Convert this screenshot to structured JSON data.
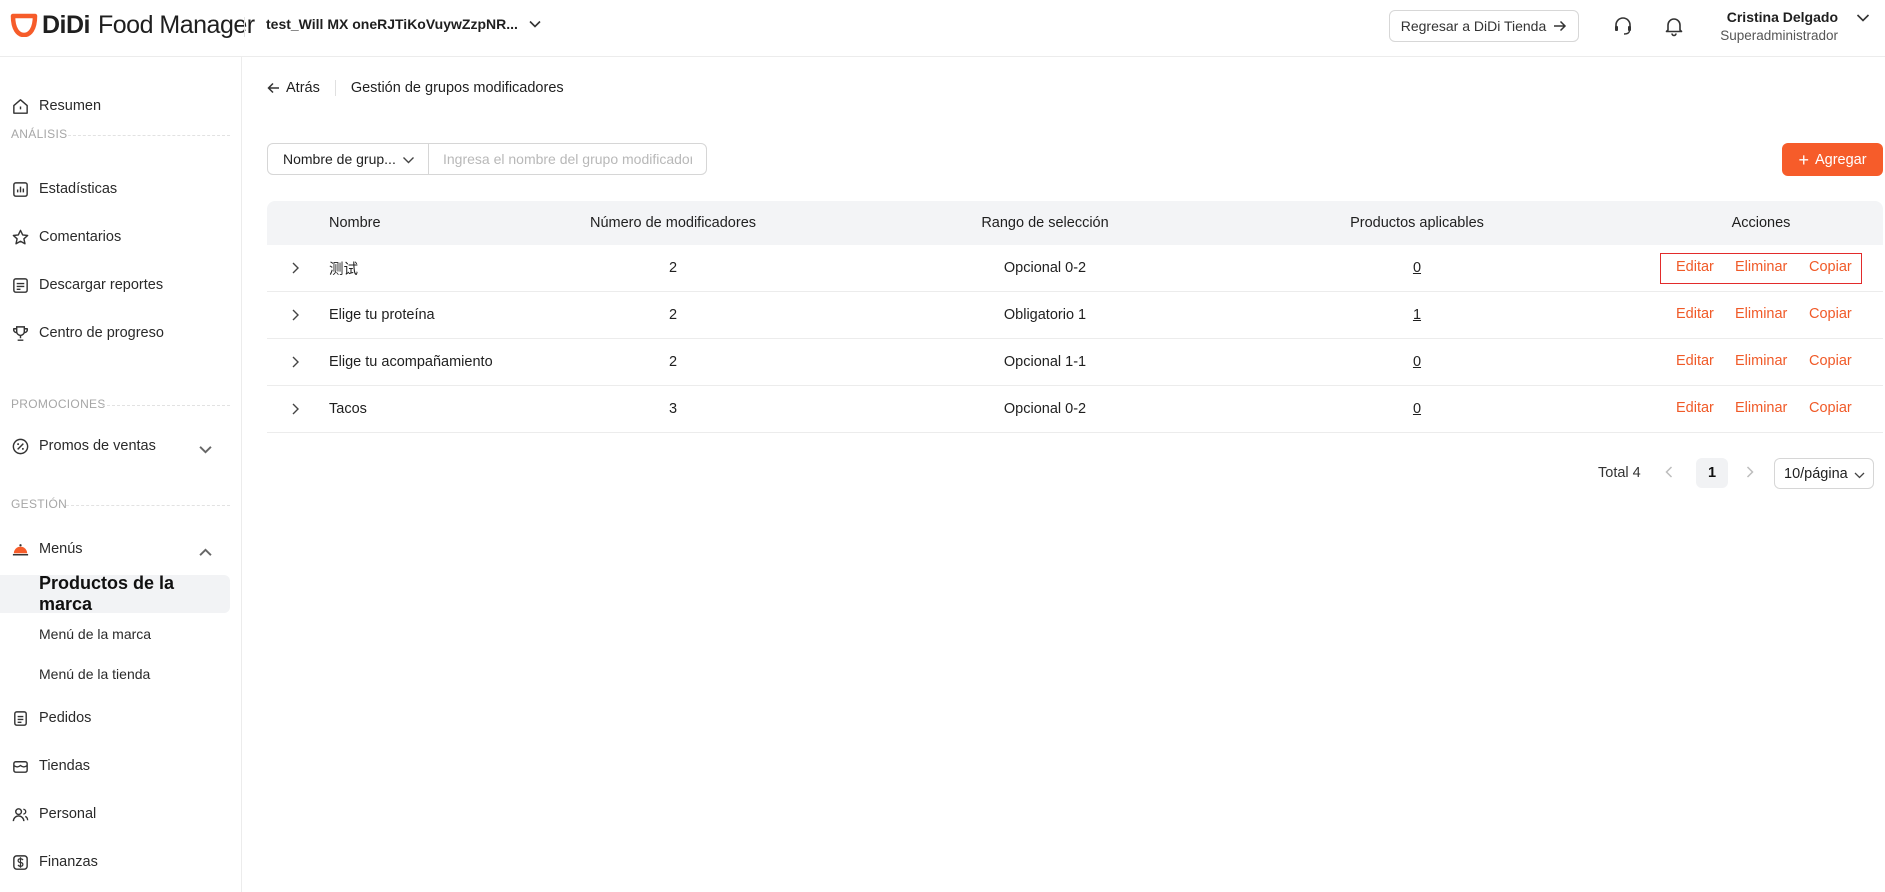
{
  "header": {
    "logo_didi": "DiDi",
    "logo_product": "Food Manager",
    "store_name": "test_Will MX oneRJTiKoVuywZzpNR...",
    "back_to_store": "Regresar a DiDi Tienda",
    "support_icon": "headset-icon",
    "notification_icon": "bell-icon",
    "user_name": "Cristina Delgado",
    "user_role": "Superadministrador"
  },
  "sidebar": {
    "resumen": "Resumen",
    "section_analisis": "ANÁLISIS",
    "estadisticas": "Estadísticas",
    "comentarios": "Comentarios",
    "descargar_reportes": "Descargar reportes",
    "centro_progreso": "Centro de progreso",
    "section_promociones": "PROMOCIONES",
    "promos_ventas": "Promos de ventas",
    "section_gestion": "GESTIÓN",
    "menus": "Menús",
    "productos_marca": "Productos de la marca",
    "menu_marca": "Menú de la marca",
    "menu_tienda": "Menú de la tienda",
    "pedidos": "Pedidos",
    "tiendas": "Tiendas",
    "personal": "Personal",
    "finanzas": "Finanzas"
  },
  "breadcrumb": {
    "back": "Atrás",
    "current": "Gestión de grupos modificadores"
  },
  "filters": {
    "select_value": "Nombre de grup...",
    "search_placeholder": "Ingresa el nombre del grupo modificador",
    "add_label": "Agregar"
  },
  "table": {
    "headers": {
      "nombre": "Nombre",
      "numero": "Número de modificadores",
      "rango": "Rango de selección",
      "productos": "Productos aplicables",
      "acciones": "Acciones"
    },
    "rows": [
      {
        "nombre": "测试",
        "numero": "2",
        "rango": "Opcional 0-2",
        "productos": "0"
      },
      {
        "nombre": "Elige tu proteína",
        "numero": "2",
        "rango": "Obligatorio 1",
        "productos": "1"
      },
      {
        "nombre": "Elige tu acompañamiento",
        "numero": "2",
        "rango": "Opcional 1-1",
        "productos": "0"
      },
      {
        "nombre": "Tacos",
        "numero": "3",
        "rango": "Opcional 0-2",
        "productos": "0"
      }
    ],
    "actions": {
      "edit": "Editar",
      "delete": "Eliminar",
      "copy": "Copiar"
    }
  },
  "pagination": {
    "total": "Total 4",
    "current_page": "1",
    "page_size": "10/página"
  },
  "colors": {
    "brand_orange": "#f65c2a",
    "action_text": "#f05a28",
    "highlight_frame": "#e22b2b"
  }
}
